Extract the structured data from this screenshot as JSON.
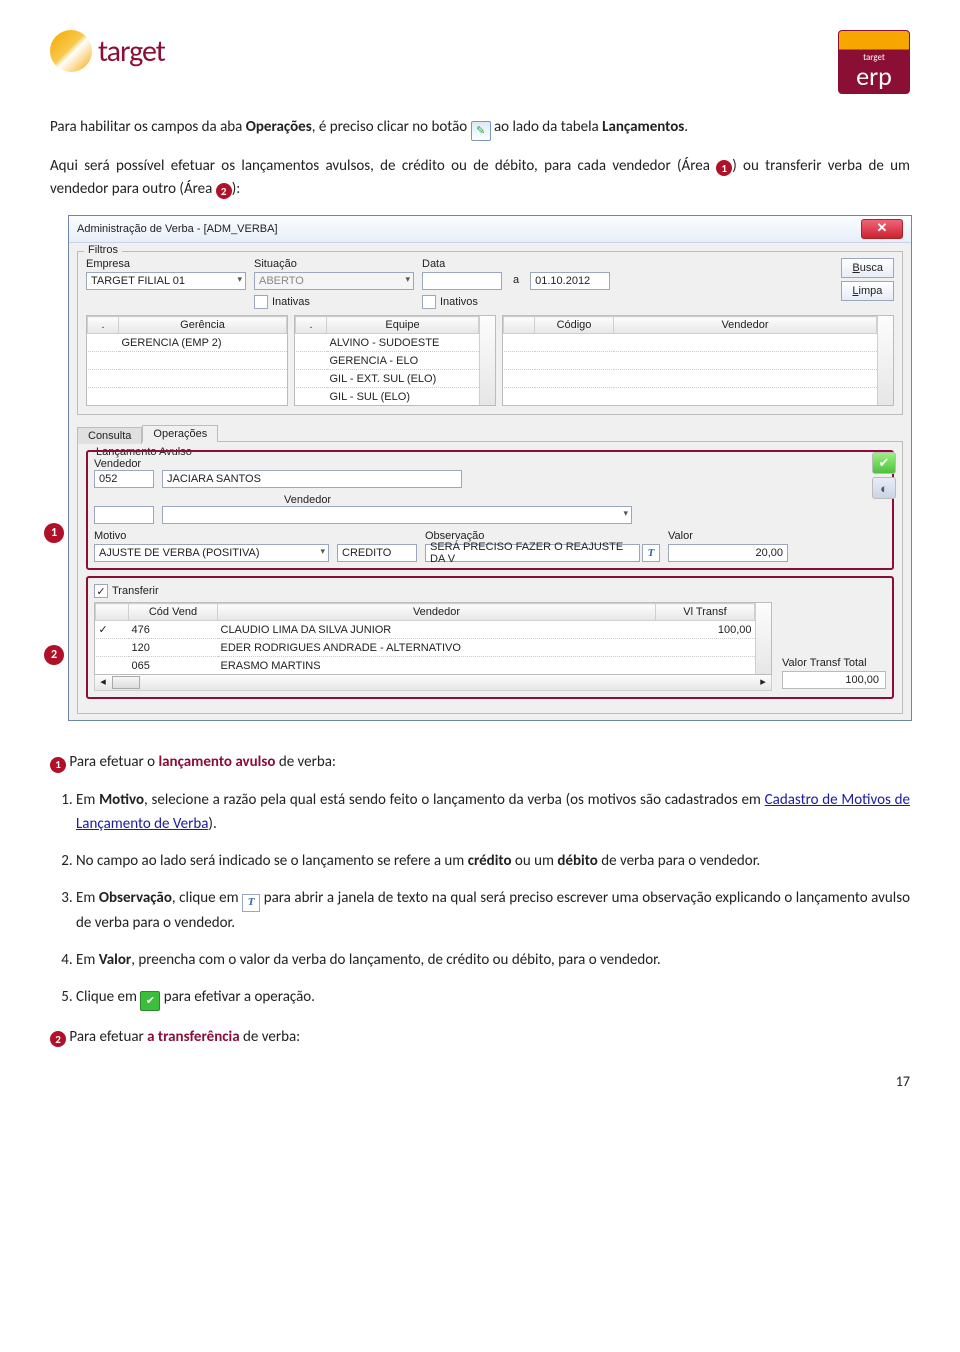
{
  "header": {
    "logo_text": "target",
    "erp_top": "target",
    "erp_main": "erp"
  },
  "intro": {
    "p1_a": "Para habilitar os campos da aba ",
    "p1_b": "Operações",
    "p1_c": ", é preciso clicar no botão ",
    "p1_d": " ao lado da tabela ",
    "p1_e": "Lançamentos",
    "p1_f": ".",
    "p2_a": "Aqui será possível efetuar os lançamentos avulsos, de crédito ou de débito, para cada vendedor (Área ",
    "p2_b": ") ou transferir verba de um vendedor para outro (Área ",
    "p2_c": "):"
  },
  "ss": {
    "title": "Administração de Verba - [ADM_VERBA]",
    "filtros_legend": "Filtros",
    "empresa_lbl": "Empresa",
    "empresa_val": "TARGET FILIAL 01",
    "situacao_lbl": "Situação",
    "situacao_val": "ABERTO",
    "data_lbl": "Data",
    "data_sep": "a",
    "data_end": "01.10.2012",
    "busca_btn": "Busca",
    "limpa_btn": "Limpa",
    "inativas_lbl": "Inativas",
    "inativos_lbl": "Inativos",
    "gerencia_hdr": "Gerência",
    "gerencia_val": "GERENCIA (EMP 2)",
    "equipe_hdr": "Equipe",
    "equipe_vals": [
      "ALVINO - SUDOESTE",
      "GERENCIA - ELO",
      "GIL - EXT. SUL (ELO)",
      "GIL - SUL (ELO)"
    ],
    "codigo_hdr": "Código",
    "vendedor_hdr": "Vendedor",
    "tab_consulta": "Consulta",
    "tab_operacoes": "Operações",
    "lancamento_legend": "Lançamento Avulso",
    "vendedor_lbl": "Vendedor",
    "vendedor_code": "052",
    "vendedor_name": "JACIARA SANTOS",
    "vendedor_hdr2": "Vendedor",
    "motivo_lbl": "Motivo",
    "motivo_val": "AJUSTE DE VERBA (POSITIVA)",
    "tipo_val": "CREDITO",
    "obs_lbl": "Observação",
    "obs_val": "SERÁ PRECISO FAZER O REAJUSTE DA V",
    "valor_lbl": "Valor",
    "valor_val": "20,00",
    "transferir_lbl": "Transferir",
    "tbl_cod": "Cód Vend",
    "tbl_vend": "Vendedor",
    "tbl_vl": "Vl Transf",
    "rows": [
      {
        "cod": "476",
        "vend": "CLAUDIO LIMA DA SILVA JUNIOR",
        "vl": "100,00",
        "chk": "✓"
      },
      {
        "cod": "120",
        "vend": "EDER RODRIGUES ANDRADE - ALTERNATIVO",
        "vl": "",
        "chk": ""
      },
      {
        "cod": "065",
        "vend": "ERASMO MARTINS",
        "vl": "",
        "chk": ""
      }
    ],
    "valor_transf_lbl": "Valor Transf Total",
    "valor_transf_val": "100,00"
  },
  "body": {
    "lead1_a": " Para efetuar o ",
    "lead1_b": "lançamento avulso",
    "lead1_c": " de verba:",
    "step1_a": "Em ",
    "step1_b": "Motivo",
    "step1_c": ", selecione a razão pela qual está sendo feito o lançamento da verba (os motivos são cadastrados em ",
    "step1_d": "Cadastro de Motivos de Lançamento de Verba",
    "step1_e": ").",
    "step2_a": "No campo ao lado será indicado se o lançamento se refere a um ",
    "step2_b": "crédito",
    "step2_c": " ou um ",
    "step2_d": "débito",
    "step2_e": " de verba para o vendedor.",
    "step3_a": "Em ",
    "step3_b": "Observação",
    "step3_c": ", clique em ",
    "step3_d": " para abrir a janela de texto na qual será preciso escrever uma observação explicando o lançamento avulso de verba para o vendedor.",
    "step4_a": "Em ",
    "step4_b": "Valor",
    "step4_c": ", preencha com o valor da verba do lançamento, de crédito ou débito, para o vendedor.",
    "step5_a": "Clique em ",
    "step5_b": " para efetivar a operação.",
    "lead2_a": " Para efetuar ",
    "lead2_b": "a transferência",
    "lead2_c": " de verba:"
  },
  "page_num": "17"
}
